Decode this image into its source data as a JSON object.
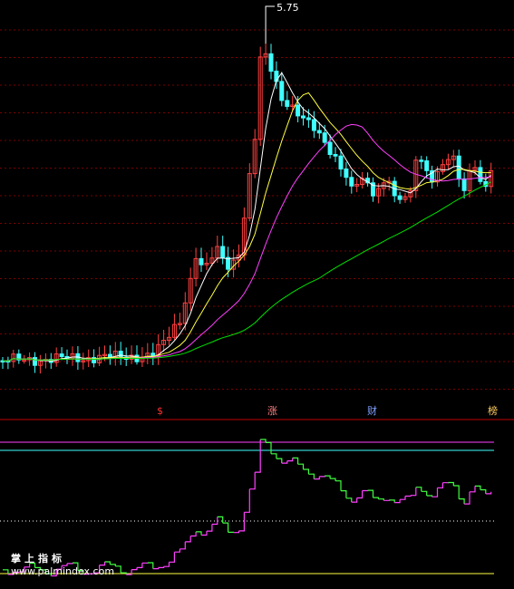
{
  "chart_data": {
    "type": "candlestick",
    "peak_label": "5.75",
    "watermark": {
      "line1": "掌上指标",
      "line2": "www.palmindex.com"
    },
    "signals": [
      {
        "text": "$",
        "color": "#ff3030"
      },
      {
        "text": "涨",
        "color": "#ff8080"
      },
      {
        "text": "财",
        "color": "#80a0ff"
      },
      {
        "text": "榜",
        "color": "#ffcc60"
      }
    ],
    "ma_colors": {
      "ma_short": "#ffffff",
      "ma_mid": "#ffff40",
      "ma_long": "#ff40ff",
      "ma_longest": "#00e000"
    },
    "indicator": {
      "upper_lines": [
        "#ff40ff",
        "#40ffff"
      ],
      "lower_line": "#ffff40",
      "mid_dotted": "#ffffff",
      "rise_color": "#ff40ff",
      "fall_color": "#40ff40"
    }
  }
}
